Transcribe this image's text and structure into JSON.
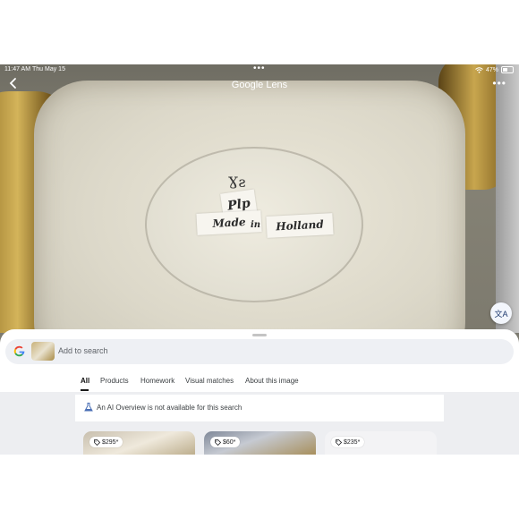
{
  "status_bar": {
    "time": "11:47 AM",
    "date": "Thu May 15",
    "battery": "47%",
    "dots": "•••"
  },
  "header": {
    "back_icon": "chevron-left-icon",
    "title": "Google Lens",
    "more": "•••"
  },
  "photo": {
    "stickers": {
      "line1": "Plp",
      "line2a": "Made",
      "line2b": "in",
      "line2c": "Holland"
    },
    "mark": "Ɣƨ"
  },
  "translate_button": {
    "icon": "translate-icon",
    "glyph": "文A"
  },
  "search": {
    "logo": "G",
    "placeholder": "Add to search"
  },
  "tabs": [
    {
      "label": "All",
      "active": true
    },
    {
      "label": "Products"
    },
    {
      "label": "Homework"
    },
    {
      "label": "Visual matches"
    },
    {
      "label": "About this image"
    }
  ],
  "ai_overview": {
    "icon": "flask-icon",
    "text": "An AI Overview is not available for this search"
  },
  "products": [
    {
      "price": "$295*"
    },
    {
      "price": "$60*"
    },
    {
      "price": "$235*"
    }
  ]
}
